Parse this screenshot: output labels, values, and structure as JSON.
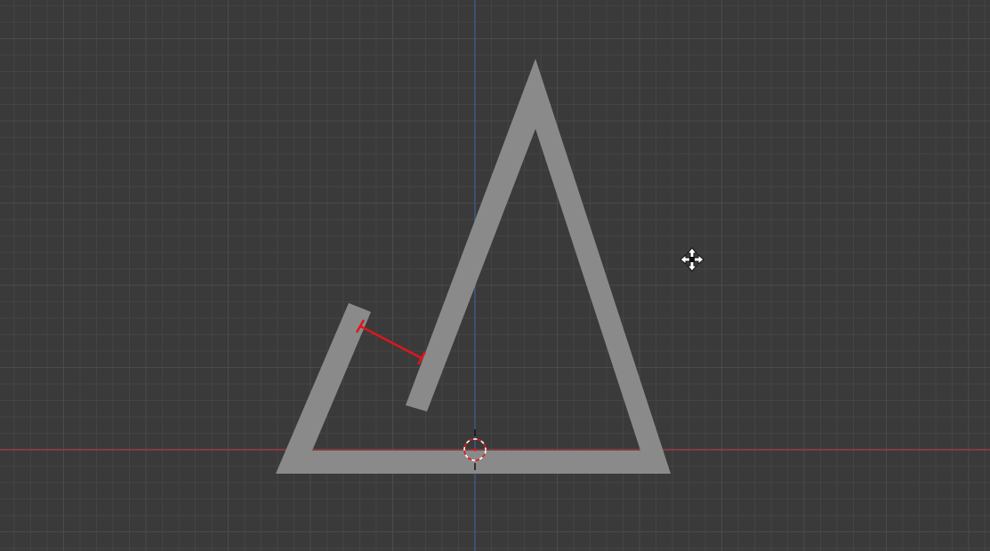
{
  "viewport": {
    "background_color": "#3a3a3a",
    "minor_grid_color": "#444444",
    "major_grid_color": "#4b4b4b",
    "x_axis_color": "#b03a44",
    "y_axis_color": "#3d5f93",
    "mesh_color": "#8a8a8a",
    "measure_color": "#e0151c"
  },
  "icons": {
    "world_origin": "origin-crosshair-icon",
    "move_cursor": "move-cursor-icon"
  }
}
